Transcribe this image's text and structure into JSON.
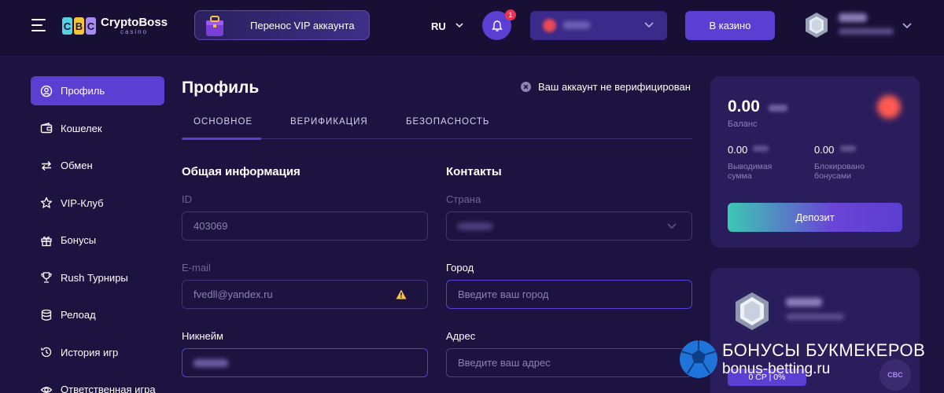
{
  "header": {
    "logo_name": "CryptoBoss",
    "logo_sub": "casino",
    "logo_coins": [
      "C",
      "B",
      "C"
    ],
    "vip_banner": "Перенос VIP аккаунта",
    "language": "RU",
    "notification_count": "1",
    "casino_button": "В казино"
  },
  "sidebar": {
    "items": [
      {
        "label": "Профиль",
        "icon": "user-icon"
      },
      {
        "label": "Кошелек",
        "icon": "wallet-icon"
      },
      {
        "label": "Обмен",
        "icon": "exchange-icon"
      },
      {
        "label": "VIP-Клуб",
        "icon": "star-icon"
      },
      {
        "label": "Бонусы",
        "icon": "gift-icon"
      },
      {
        "label": "Rush Турниры",
        "icon": "trophy-icon"
      },
      {
        "label": "Релоад",
        "icon": "database-icon"
      },
      {
        "label": "История игр",
        "icon": "history-icon"
      },
      {
        "label": "Ответственная игра",
        "icon": "eye-icon"
      }
    ]
  },
  "main": {
    "title": "Профиль",
    "verify_note": "Ваш аккаунт не верифицирован",
    "tabs": [
      "ОСНОВНОЕ",
      "ВЕРИФИКАЦИЯ",
      "БЕЗОПАСНОСТЬ"
    ],
    "general": {
      "title": "Общая информация",
      "id_label": "ID",
      "id_value": "403069",
      "email_label": "E-mail",
      "email_value": "fvedll@yandex.ru",
      "nickname_label": "Никнейм"
    },
    "contacts": {
      "title": "Контакты",
      "country_label": "Страна",
      "city_label": "Город",
      "city_placeholder": "Введите ваш город",
      "address_label": "Адрес",
      "address_placeholder": "Введите ваш адрес"
    }
  },
  "balance": {
    "amount": "0.00",
    "label": "Баланс",
    "withdrawable_amount": "0.00",
    "withdrawable_label_1": "Выводимая",
    "withdrawable_label_2": "сумма",
    "bonus_amount": "0.00",
    "bonus_label_1": "Блокировано",
    "bonus_label_2": "бонусами",
    "deposit_button": "Депозит"
  },
  "level": {
    "cp_text": "0 CP | 0%"
  },
  "watermark": {
    "line1": "БОНУСЫ БУКМЕКЕРОВ",
    "line2": "bonus-betting.ru"
  },
  "colors": {
    "background": "#1c1340",
    "header": "#180f35",
    "accent": "#5b3fd2",
    "card": "#2a1d5c"
  }
}
